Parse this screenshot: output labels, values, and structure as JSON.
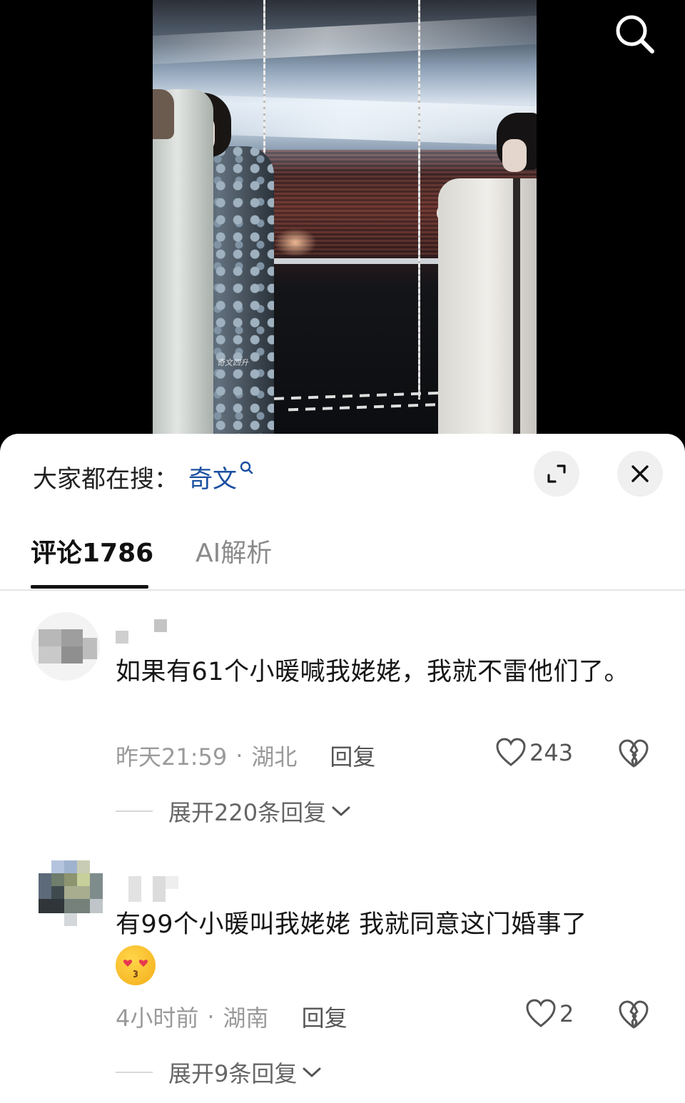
{
  "video": {
    "watermark": "奇文四升"
  },
  "top_bar": {
    "search_icon": "search-icon"
  },
  "sheet": {
    "suggest_prefix": "大家都在搜：",
    "suggest_term": "奇文",
    "expand_icon": "expand-icon",
    "close_icon": "close-icon"
  },
  "tabs": [
    {
      "label": "评论1786",
      "active": true
    },
    {
      "label": "AI解析",
      "active": false
    }
  ],
  "comments": [
    {
      "text": "如果有61个小暖喊我姥姥，我就不雷他们了。",
      "time": "昨天21:59",
      "location": "湖北",
      "reply_label": "回复",
      "likes": "243",
      "expand_label": "展开220条回复"
    },
    {
      "text": "有99个小暖叫我姥姥  我就同意这门婚事了",
      "emoji": "heart-eyes-kiss-emoji",
      "time": "4小时前",
      "location": "湖南",
      "reply_label": "回复",
      "likes": "2",
      "expand_label": "展开9条回复"
    }
  ],
  "colors": {
    "accent_link": "#1a4fa0",
    "meta_gray": "#9a9a9a",
    "sheet_bg": "#ffffff"
  }
}
